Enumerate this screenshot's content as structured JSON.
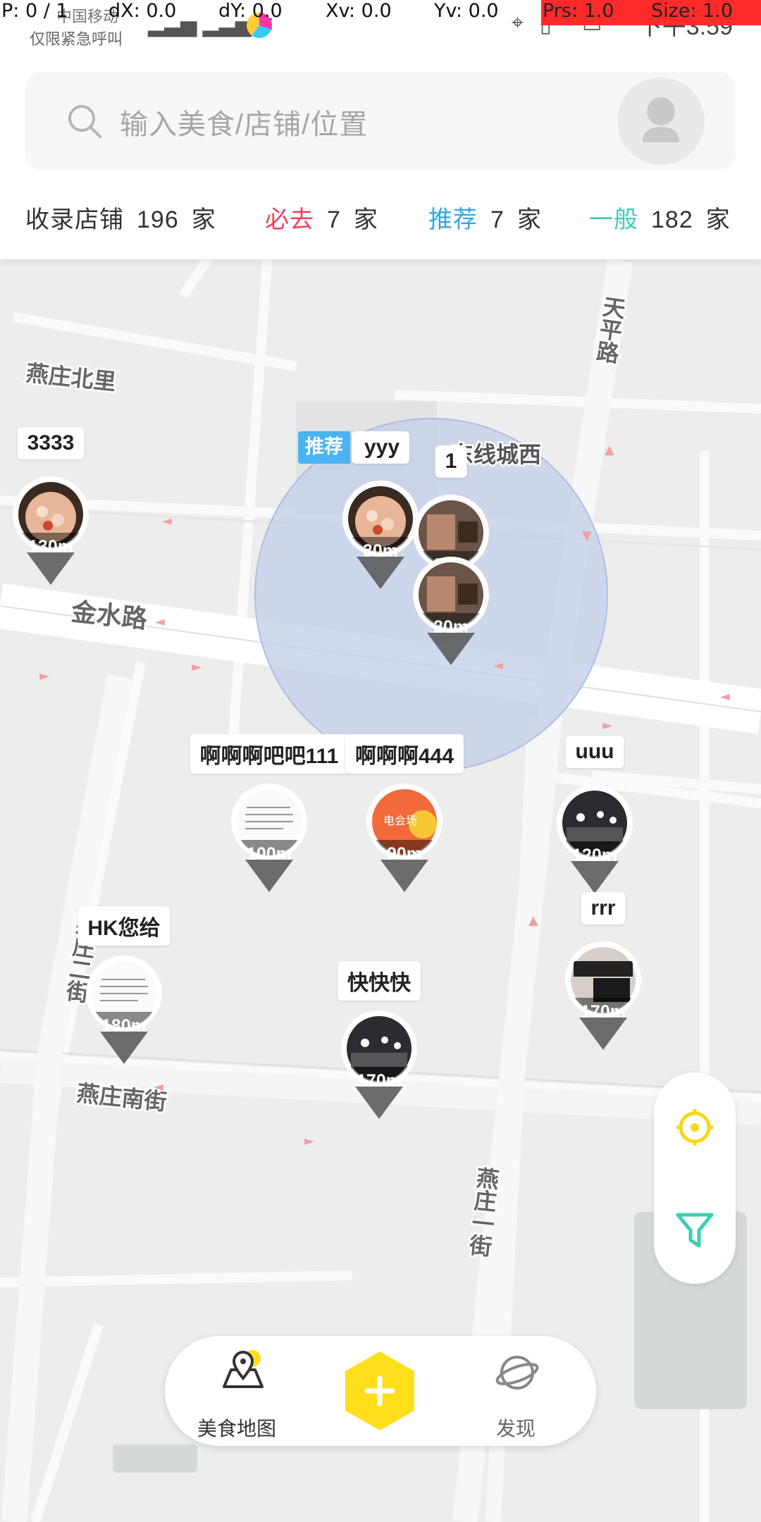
{
  "debug_bar": {
    "p": "P: 0 / 1",
    "dx": "dX: 0.0",
    "dy": "dY: 0.0",
    "xv": "Xv: 0.0",
    "yv": "Yv: 0.0",
    "prs": "Prs: 1.0",
    "size": "Size: 1.0"
  },
  "status_bar": {
    "carrier": "中国移动",
    "carrier_sub": "仅限紧急呼叫",
    "time": "下午3:59"
  },
  "search": {
    "placeholder": "输入美食/店铺/位置"
  },
  "stats": {
    "total_label": "收录店铺",
    "total_count": "196",
    "total_unit": "家",
    "must_label": "必去",
    "must_count": "7",
    "must_unit": "家",
    "rec_label": "推荐",
    "rec_count": "7",
    "rec_unit": "家",
    "normal_label": "一般",
    "normal_count": "182",
    "normal_unit": "家",
    "colors": {
      "must": "#f0405c",
      "rec": "#2ea6e8",
      "normal": "#3bd0b2"
    }
  },
  "map_labels": {
    "north_street": "燕庄北里",
    "jinshui_road": "金水路",
    "tianping_road": "天平路",
    "yanzhuang_2nd": "燕庄二街",
    "yanzhuang_south": "燕庄南街",
    "yanzhuang_1st": "燕庄一街",
    "dongfeng_west": "东线城西"
  },
  "markers": [
    {
      "name": "3333",
      "dist": "130m"
    },
    {
      "name": "yyy",
      "dist": "30m",
      "badge": "推荐"
    },
    {
      "name": "1",
      "dist": "30m"
    },
    {
      "name": "",
      "dist": "20m"
    },
    {
      "name": "啊啊啊吧吧111",
      "dist": "100m"
    },
    {
      "name": "啊啊啊444",
      "dist": "90m"
    },
    {
      "name": "uuu",
      "dist": "120m"
    },
    {
      "name": "rrr",
      "dist": "170m"
    },
    {
      "name": "HK您给",
      "dist": "180m"
    },
    {
      "name": "快快快",
      "dist": "170m"
    }
  ],
  "side_buttons": {
    "locate_icon": "locate-icon",
    "filter_icon": "filter-icon",
    "accent": "#f8d71c",
    "filter_color": "#3bd0b2"
  },
  "bottom_nav": {
    "food_map": "美食地图",
    "discover": "发现",
    "add_color": "#ffdf1b"
  }
}
